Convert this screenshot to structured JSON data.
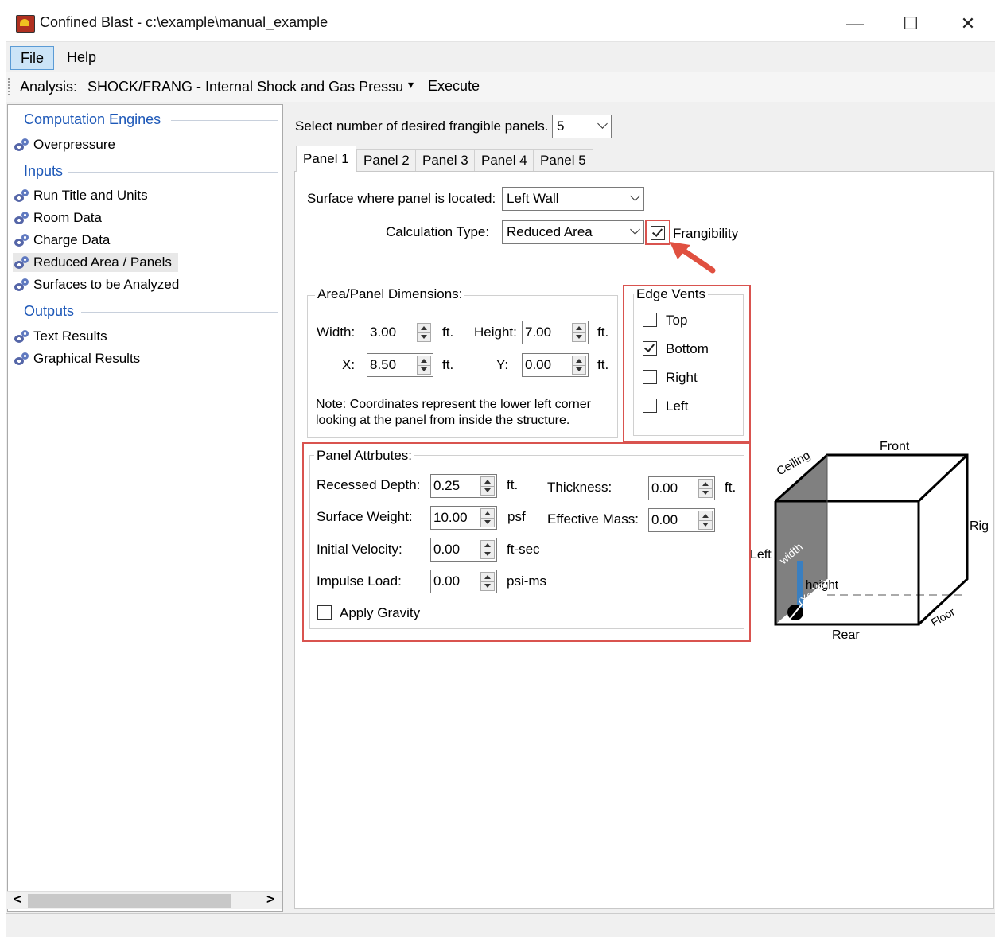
{
  "window": {
    "title": "Confined Blast - c:\\example\\manual_example",
    "minimize_glyph": "—",
    "maximize_glyph": "☐",
    "close_glyph": "✕"
  },
  "menu": {
    "file": "File",
    "help": "Help"
  },
  "toolbar": {
    "analysis_label": "Analysis:",
    "analysis_value": "SHOCK/FRANG - Internal Shock and Gas Pressu",
    "dropdown_glyph": "▾",
    "execute": "Execute"
  },
  "sidebar": {
    "computation_engines": "Computation Engines",
    "overpressure": "Overpressure",
    "inputs": "Inputs",
    "run_title": "Run Title and Units",
    "room_data": "Room Data",
    "charge_data": "Charge Data",
    "reduced_area": "Reduced Area / Panels",
    "surfaces": "Surfaces to be Analyzed",
    "outputs": "Outputs",
    "text_results": "Text Results",
    "graphical_results": "Graphical Results",
    "scroll_left": "<",
    "scroll_right": ">"
  },
  "panels": {
    "count_label": "Select number of desired frangible panels.",
    "count_value": "5",
    "tabs": [
      "Panel 1",
      "Panel 2",
      "Panel 3",
      "Panel 4",
      "Panel 5"
    ]
  },
  "panel": {
    "surface_label": "Surface where panel is located:",
    "surface_value": "Left Wall",
    "calc_label": "Calculation Type:",
    "calc_value": "Reduced Area",
    "frangibility_label": "Frangibility",
    "frangibility_checked": true,
    "dims": {
      "title": "Area/Panel Dimensions:",
      "width_label": "Width:",
      "width": "3.00",
      "width_unit": "ft.",
      "height_label": "Height:",
      "height": "7.00",
      "height_unit": "ft.",
      "x_label": "X:",
      "x": "8.50",
      "x_unit": "ft.",
      "y_label": "Y:",
      "y": "0.00",
      "y_unit": "ft.",
      "note_line1": "Note: Coordinates represent the lower left corner",
      "note_line2": "looking at the panel from inside the structure."
    },
    "edge_vents": {
      "title": "Edge Vents",
      "top": "Top",
      "top_checked": false,
      "bottom": "Bottom",
      "bottom_checked": true,
      "right": "Right",
      "right_checked": false,
      "left": "Left",
      "left_checked": false
    },
    "attributes": {
      "title": "Panel Attrbutes:",
      "recessed_label": "Recessed Depth:",
      "recessed": "0.25",
      "recessed_unit": "ft.",
      "thickness_label": "Thickness:",
      "thickness": "0.00",
      "thickness_unit": "ft.",
      "weight_label": "Surface Weight:",
      "weight": "10.00",
      "weight_unit": "psf",
      "mass_label": "Effective Mass:",
      "mass": "0.00",
      "velocity_label": "Initial Velocity:",
      "velocity": "0.00",
      "velocity_unit": "ft-sec",
      "impulse_label": "Impulse Load:",
      "impulse": "0.00",
      "impulse_unit": "psi-ms",
      "gravity_label": "Apply Gravity",
      "gravity_checked": false
    }
  },
  "diagram": {
    "front": "Front",
    "ceiling": "Ceiling",
    "right": "Rig",
    "left": "Left",
    "rear": "Rear",
    "floor": "Floor",
    "width": "width",
    "height": "height",
    "origin": "(Xo,Yo)"
  },
  "colors": {
    "highlight": "#d9534f",
    "accent": "#1d58b8",
    "panel_fill": "#808080",
    "height_bar": "#3a7fc0"
  }
}
